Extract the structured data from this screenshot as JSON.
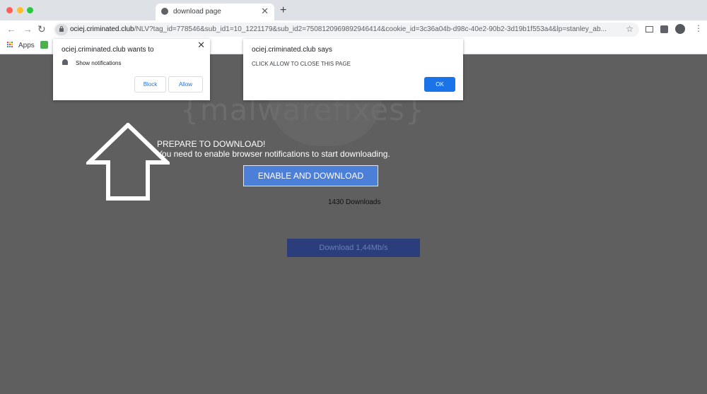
{
  "browser": {
    "tab_title": "download page",
    "url_host": "ociej.criminated.club",
    "url_path": "/NLV?tag_id=778546&sub_id1=10_1221179&sub_id2=7508120969892946414&cookie_id=3c36a04b-d98c-40e2-90b2-3d19b1f553a4&lp=stanley_ab...",
    "bookmarks_apps_label": "Apps"
  },
  "notification_prompt": {
    "site_wants": "ociej.criminated.club wants to",
    "permission_text": "Show notifications",
    "block_label": "Block",
    "allow_label": "Allow"
  },
  "alert_dialog": {
    "title": "ociej.criminated.club says",
    "message": "CLICK ALLOW TO CLOSE THIS PAGE",
    "ok_label": "OK"
  },
  "page": {
    "watermark": "{malwarefixes}",
    "headline_line1": "PREPARE TO DOWNLOAD!",
    "headline_line2": "You need to enable browser notifications to start downloading.",
    "enable_button": "ENABLE AND DOWNLOAD",
    "downloads_count": "1430 Downloads",
    "download_speed_button": "Download 1,44Mb/s"
  },
  "colors": {
    "page_background": "#5f5f5f",
    "accent_blue": "#1a73e8",
    "enable_button_bg": "#4c7fd8",
    "download_button_bg": "#2b3d7a"
  }
}
